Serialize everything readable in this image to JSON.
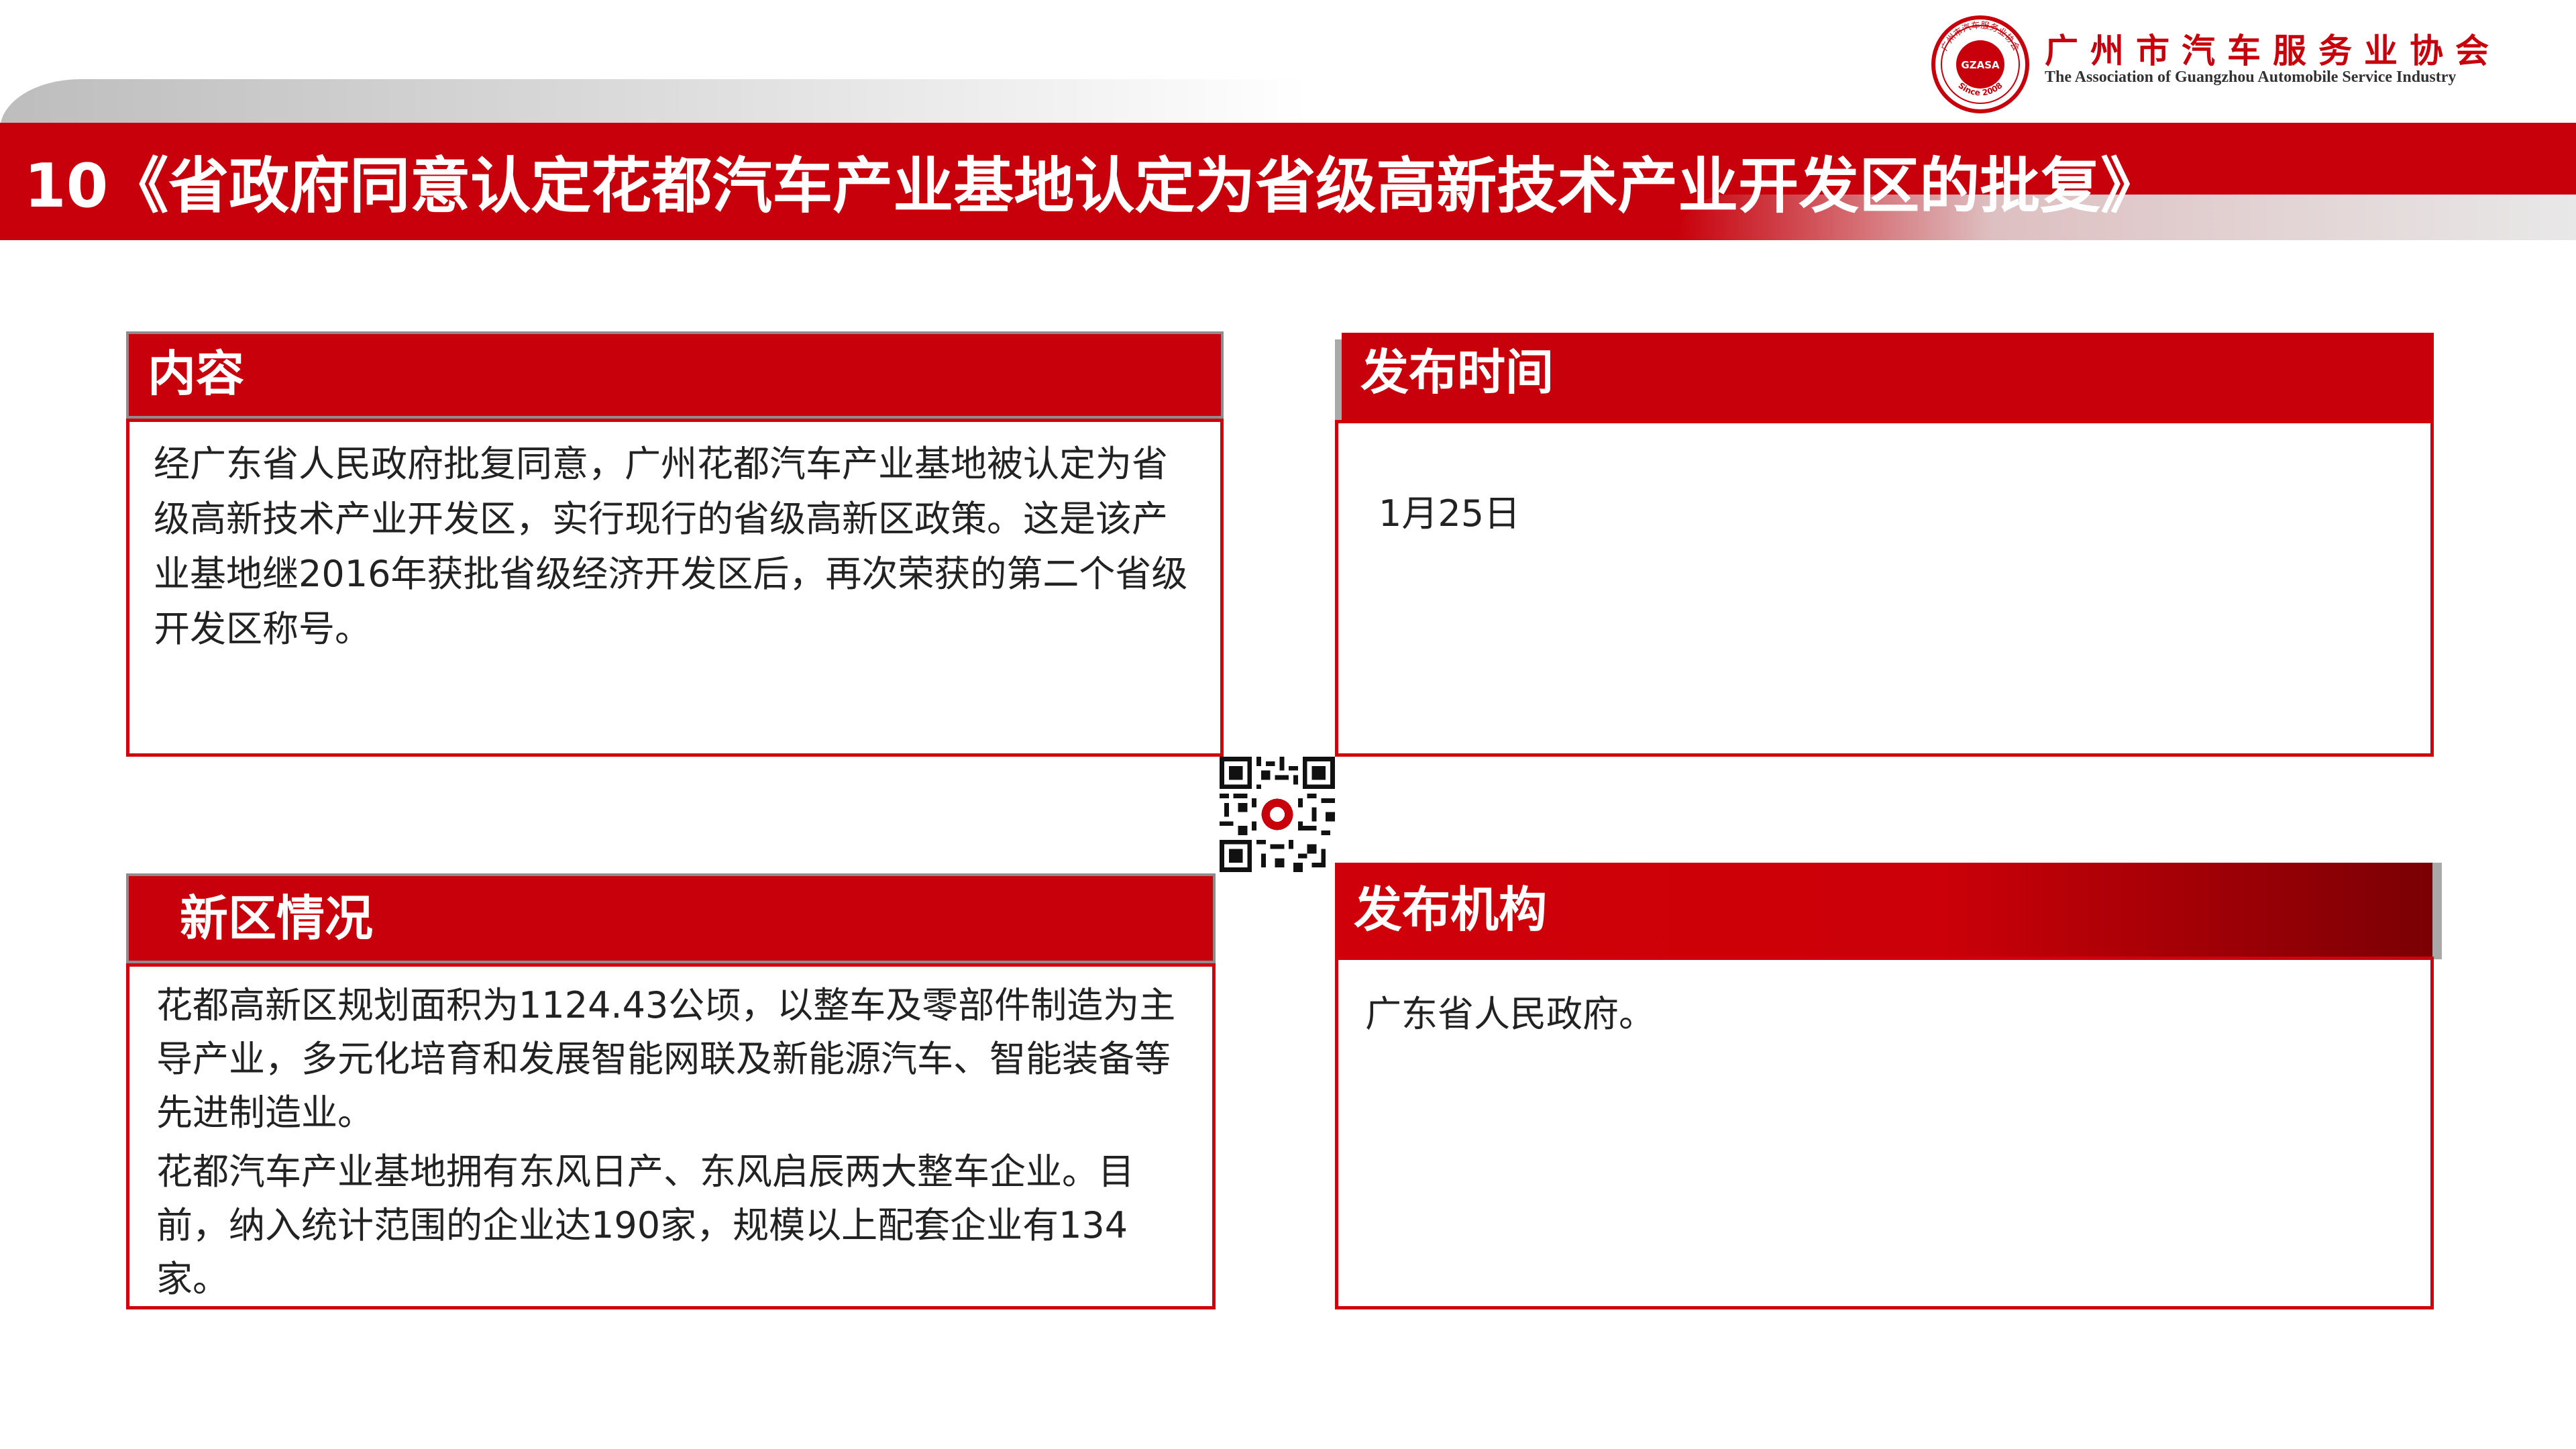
{
  "header": {
    "title": "10《省政府同意认定花都汽车产业基地认定为省级高新技术产业开发区的批复》"
  },
  "logo": {
    "name_cn": "广州市汽车服务业协会",
    "name_en": "The Association of Guangzhou Automobile Service Industry",
    "seal_abbr": "GZASA",
    "seal_ring_text": "广州市汽车服务业协会",
    "seal_since": "Since 2008",
    "icon": "association-seal-icon"
  },
  "panels": {
    "content": {
      "title": "内容",
      "text": "经广东省人民政府批复同意，广州花都汽车产业基地被认定为省级高新技术产业开发区，实行现行的省级高新区政策。这是该产业基地继2016年获批省级经济开发区后，再次荣获的第二个省级开发区称号。"
    },
    "publish_time": {
      "title": "发布时间",
      "text": "1月25日"
    },
    "new_zone": {
      "title": "新区情况",
      "paragraphs": [
        "花都高新区规划面积为1124.43公顷，以整车及零部件制造为主导产业，多元化培育和发展智能网联及新能源汽车、智能装备等先进制造业。",
        "花都汽车产业基地拥有东风日产、东风启辰两大整车企业。目前，纳入统计范围的企业达190家，规模以上配套企业有134家。"
      ]
    },
    "publisher": {
      "title": "发布机构",
      "text": "广东省人民政府。"
    }
  },
  "qr": {
    "icon": "qr-code-icon"
  },
  "colors": {
    "brand_red": "#c8000b",
    "border_gray": "#8d8d8d"
  }
}
